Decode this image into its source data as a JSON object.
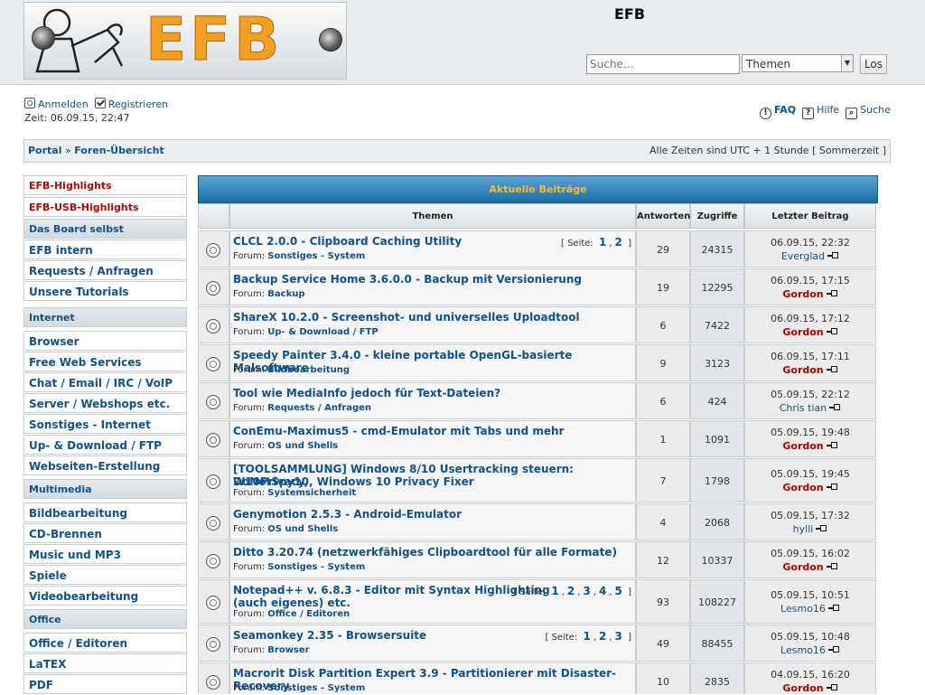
{
  "header": {
    "site_title": "EFB",
    "logo_text": "EFB",
    "search": {
      "placeholder": "Suche…",
      "select_value": "Themen",
      "button": "Los"
    }
  },
  "userbar": {
    "login": "Anmelden",
    "register": "Registrieren",
    "time": "Zeit: 06.09.15, 22:47",
    "faq": "FAQ",
    "help": "Hilfe",
    "search": "Suche"
  },
  "breadcrumb": {
    "portal": "Portal",
    "sep": "»",
    "forum_index": "Foren-Übersicht",
    "timezone": "Alle Zeiten sind UTC + 1 Stunde [ Sommerzeit ]"
  },
  "sidebar": {
    "items": [
      {
        "label": "EFB-Highlights",
        "kind": "hl"
      },
      {
        "label": "EFB-USB-Highlights",
        "kind": "hl"
      },
      {
        "label": "Das Board selbst",
        "kind": "cat"
      },
      {
        "label": "EFB intern",
        "kind": "item"
      },
      {
        "label": "Requests / Anfragen",
        "kind": "item"
      },
      {
        "label": "Unsere Tutorials",
        "kind": "item"
      },
      {
        "label": "Internet",
        "kind": "cat"
      },
      {
        "label": "Browser",
        "kind": "item"
      },
      {
        "label": "Free Web Services",
        "kind": "item"
      },
      {
        "label": "Chat / Email / IRC / VoIP etc.",
        "kind": "item"
      },
      {
        "label": "Server / Webshops etc.",
        "kind": "item"
      },
      {
        "label": "Sonstiges - Internet",
        "kind": "item"
      },
      {
        "label": "Up- & Download / FTP",
        "kind": "item"
      },
      {
        "label": "Webseiten-Erstellung",
        "kind": "item"
      },
      {
        "label": "Multimedia",
        "kind": "cat"
      },
      {
        "label": "Bildbearbeitung",
        "kind": "item"
      },
      {
        "label": "CD-Brennen",
        "kind": "item"
      },
      {
        "label": "Music und MP3",
        "kind": "item"
      },
      {
        "label": "Spiele",
        "kind": "item"
      },
      {
        "label": "Videobearbeitung",
        "kind": "item"
      },
      {
        "label": "Office",
        "kind": "cat"
      },
      {
        "label": "Office / Editoren",
        "kind": "item"
      },
      {
        "label": "LaTEX",
        "kind": "item"
      },
      {
        "label": "PDF",
        "kind": "item"
      }
    ]
  },
  "topics": {
    "title": "Aktuelle Beiträge",
    "columns": {
      "topics": "Themen",
      "replies": "Antworten",
      "views": "Zugriffe",
      "last": "Letzter Beitrag"
    },
    "forum_prefix": "Forum:",
    "pages_label": "[ Seite:",
    "pages_close": "]",
    "rows": [
      {
        "title": [
          "CLCL 2.0.0 - Clipboard Caching Utility"
        ],
        "forum": "Sonstiges - System",
        "pages": [
          "1",
          "2"
        ],
        "replies": "29",
        "views": "24315",
        "date": "06.09.15, 22:32",
        "author": "Everglad",
        "mod": false
      },
      {
        "title": [
          "Backup Service Home 3.6.0.0 - Backup mit Versionierung"
        ],
        "forum": "Backup",
        "pages": [],
        "replies": "19",
        "views": "12295",
        "date": "06.09.15, 17:15",
        "author": "Gordon",
        "mod": true
      },
      {
        "title": [
          "ShareX 10.2.0 - Screenshot- und universelles Uploadtool"
        ],
        "forum": "Up- & Download / FTP",
        "pages": [],
        "replies": "6",
        "views": "7422",
        "date": "06.09.15, 17:12",
        "author": "Gordon",
        "mod": true
      },
      {
        "title": [
          "Speedy Painter 3.4.0 - kleine portable OpenGL-basierte Malsoftware"
        ],
        "forum": "Bildbearbeitung",
        "pages": [],
        "replies": "9",
        "views": "3123",
        "date": "06.09.15, 17:11",
        "author": "Gordon",
        "mod": true
      },
      {
        "title": [
          "Tool wie MediaInfo jedoch für Text-Dateien?"
        ],
        "forum": "Requests / Anfragen",
        "pages": [],
        "replies": "6",
        "views": "424",
        "date": "05.09.15, 22:12",
        "author": "Chris tian",
        "mod": false
      },
      {
        "title": [
          "ConEmu-Maximus5 - cmd-Emulator mit Tabs und mehr"
        ],
        "forum": "OS und Shells",
        "pages": [],
        "replies": "1",
        "views": "1091",
        "date": "05.09.15, 19:48",
        "author": "Gordon",
        "mod": true
      },
      {
        "title": [
          "[TOOLSAMMLUNG] Windows 8/10 Usertracking steuern: W10Privacy,",
          "DoNotSpy10, Windows 10 Privacy Fixer"
        ],
        "forum": "Systemsicherheit",
        "pages": [],
        "replies": "7",
        "views": "1798",
        "date": "05.09.15, 19:45",
        "author": "Gordon",
        "mod": true
      },
      {
        "title": [
          "Genymotion 2.5.3 - Android-Emulator"
        ],
        "forum": "OS und Shells",
        "pages": [],
        "replies": "4",
        "views": "2068",
        "date": "05.09.15, 17:32",
        "author": "hylli",
        "mod": false
      },
      {
        "title": [
          "Ditto 3.20.74 (netzwerkfähiges Clipboardtool für alle Formate)"
        ],
        "forum": "Sonstiges - System",
        "pages": [],
        "replies": "12",
        "views": "10337",
        "date": "05.09.15, 16:02",
        "author": "Gordon",
        "mod": true
      },
      {
        "title": [
          "Notepad++ v. 6.8.3 - Editor mit Syntax Highlighting",
          "(auch eigenes) etc."
        ],
        "forum": "Office / Editoren",
        "pages": [
          "1",
          "2",
          "3",
          "4",
          "5"
        ],
        "replies": "93",
        "views": "108227",
        "date": "05.09.15, 10:51",
        "author": "Lesmo16",
        "mod": false
      },
      {
        "title": [
          "Seamonkey 2.35 - Browsersuite"
        ],
        "forum": "Browser",
        "pages": [
          "1",
          "2",
          "3"
        ],
        "replies": "49",
        "views": "88455",
        "date": "05.09.15, 10:48",
        "author": "Lesmo16",
        "mod": false
      },
      {
        "title": [
          "Macrorit Disk Partition Expert 3.9 - Partitionierer mit Disaster-Recovery"
        ],
        "forum": "Sonstiges - System",
        "pages": [],
        "replies": "10",
        "views": "2835",
        "date": "04.09.15, 16:20",
        "author": "Gordon",
        "mod": true
      }
    ]
  }
}
